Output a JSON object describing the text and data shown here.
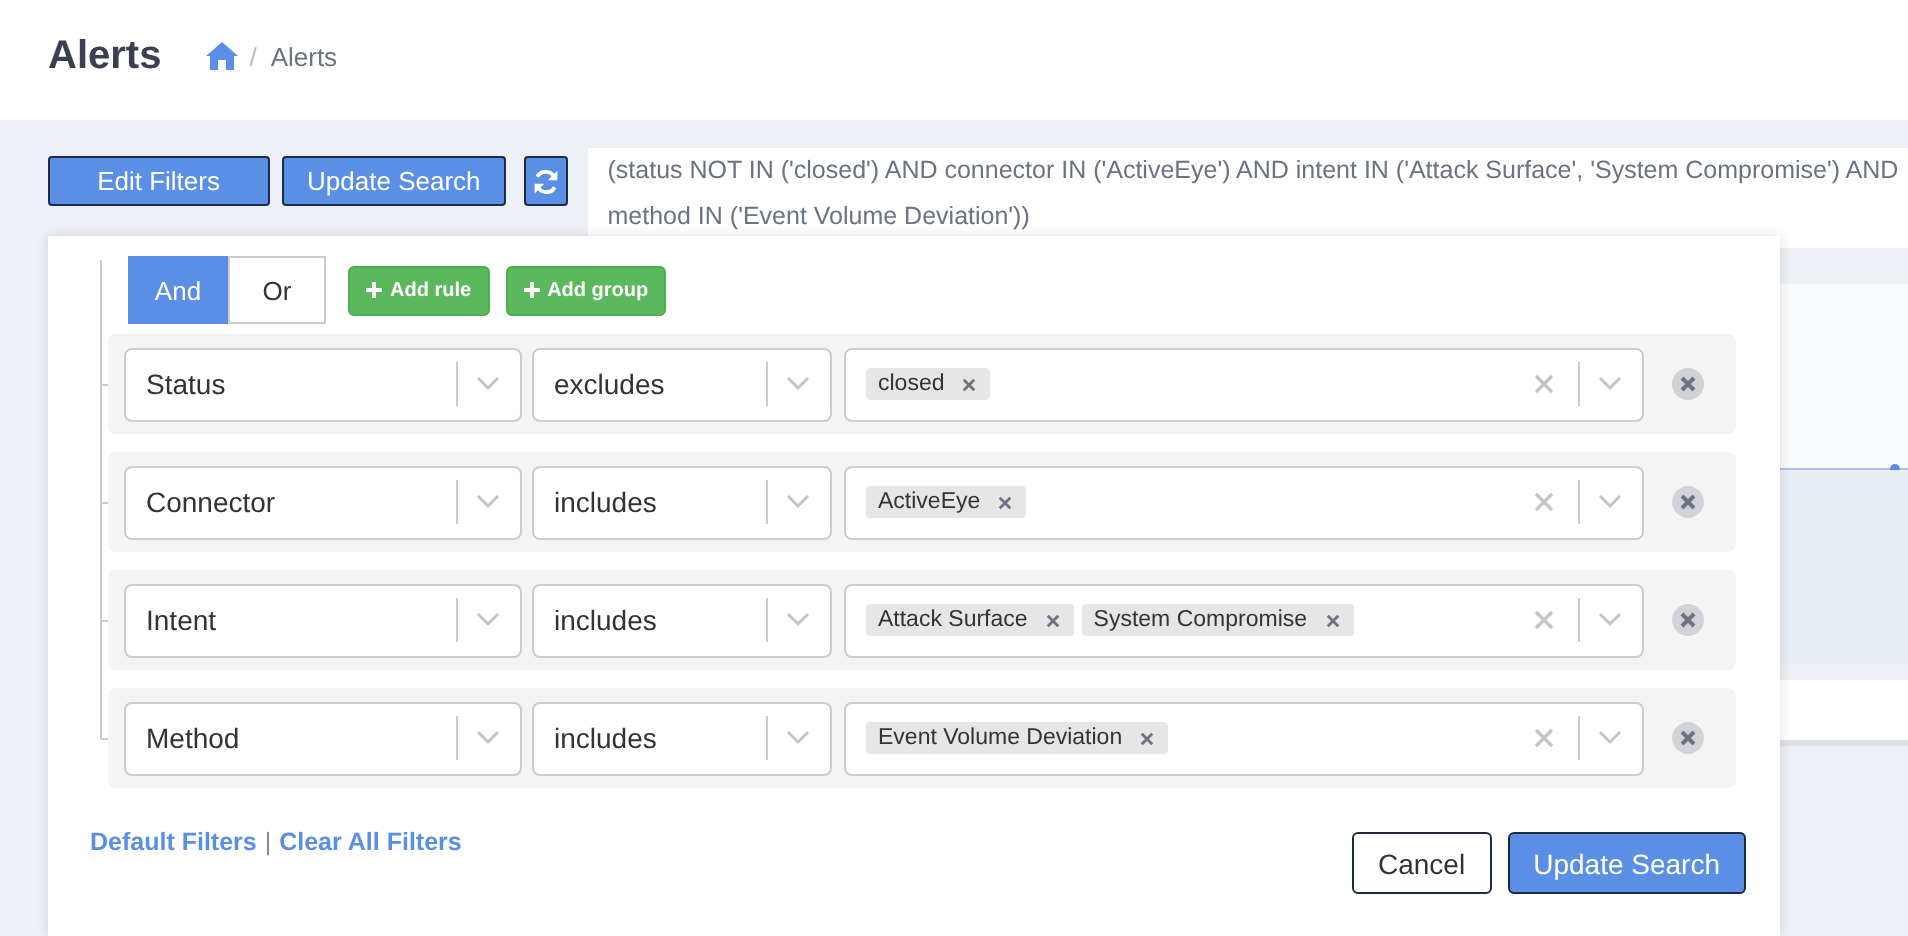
{
  "page_title": "Alerts",
  "breadcrumb": {
    "separator": "/",
    "current": "Alerts"
  },
  "toolbar": {
    "buttons": [
      "Edit Filters",
      "Update Search"
    ]
  },
  "query_text": "(status NOT IN ('closed') AND connector IN ('ActiveEye') AND intent IN ('Attack Surface', 'System Compromise') AND method IN ('Event Volume Deviation'))",
  "filter_builder": {
    "combinators": [
      {
        "label": "And",
        "selected": true
      },
      {
        "label": "Or",
        "selected": false
      }
    ],
    "add_buttons": [
      "Add rule",
      "Add group"
    ],
    "rules": [
      {
        "field": "Status",
        "operator": "excludes",
        "values": [
          "closed"
        ]
      },
      {
        "field": "Connector",
        "operator": "includes",
        "values": [
          "ActiveEye"
        ]
      },
      {
        "field": "Intent",
        "operator": "includes",
        "values": [
          "Attack Surface",
          "System Compromise"
        ]
      },
      {
        "field": "Method",
        "operator": "includes",
        "values": [
          "Event Volume Deviation"
        ]
      }
    ],
    "links": [
      "Default Filters",
      "Clear All Filters"
    ],
    "link_separator": "|",
    "buttons": [
      {
        "label": "Cancel",
        "kind": "secondary"
      },
      {
        "label": "Update Search",
        "kind": "primary"
      }
    ]
  }
}
